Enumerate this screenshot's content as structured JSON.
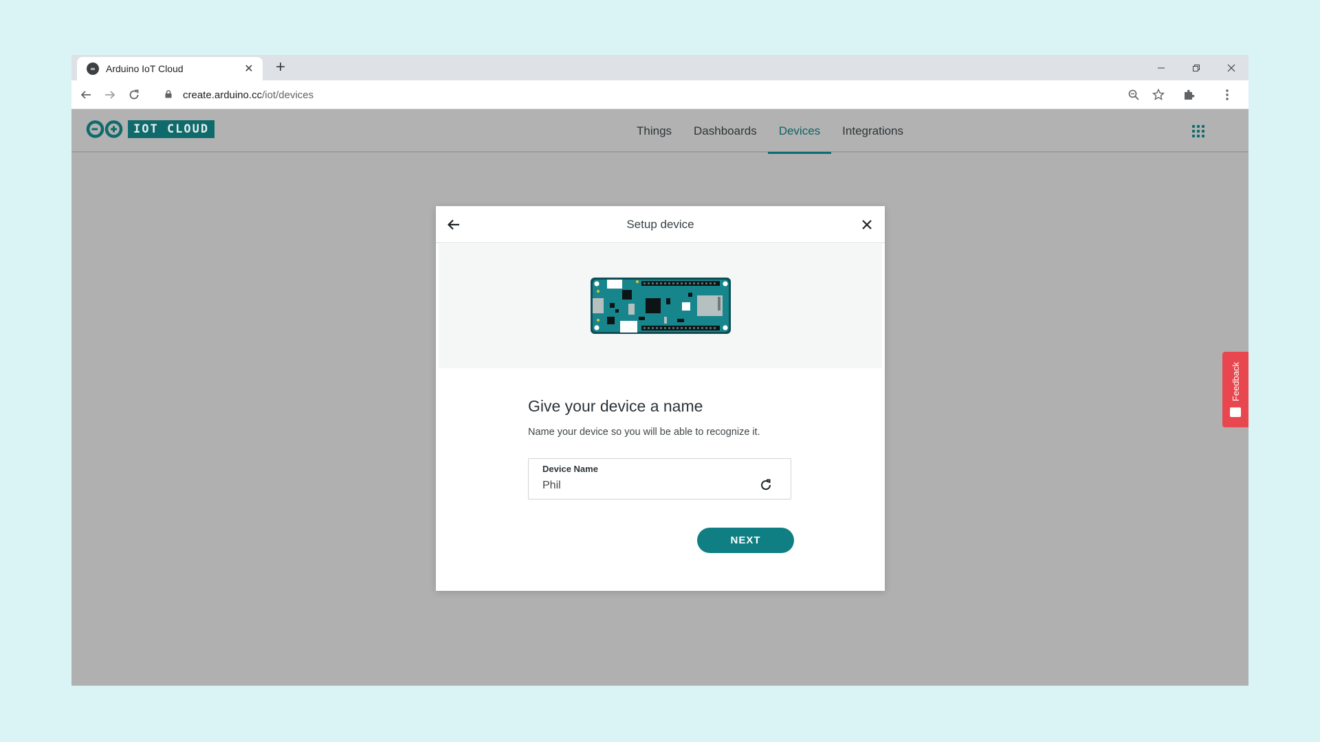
{
  "browser": {
    "tab": {
      "title": "Arduino IoT Cloud",
      "favicon": "arduino-logo-icon",
      "close_glyph": "✕"
    },
    "new_tab_glyph": "+",
    "address": {
      "domain": "create.arduino.cc",
      "path": "/iot/devices"
    },
    "window_controls": [
      "minimize-icon",
      "restore-icon",
      "close-icon"
    ]
  },
  "app": {
    "logo_text": "IOT CLOUD",
    "nav": [
      {
        "label": "Things",
        "active": false
      },
      {
        "label": "Dashboards",
        "active": false
      },
      {
        "label": "Devices",
        "active": true
      },
      {
        "label": "Integrations",
        "active": false
      }
    ],
    "accent_color": "#0f7f83"
  },
  "modal": {
    "title": "Setup device",
    "heading": "Give your device a name",
    "description": "Name your device so you will be able to recognize it.",
    "field": {
      "label": "Device Name",
      "value": "Phil"
    },
    "next_label": "NEXT"
  },
  "feedback": {
    "label": "Feedback",
    "color": "#e8474f"
  }
}
